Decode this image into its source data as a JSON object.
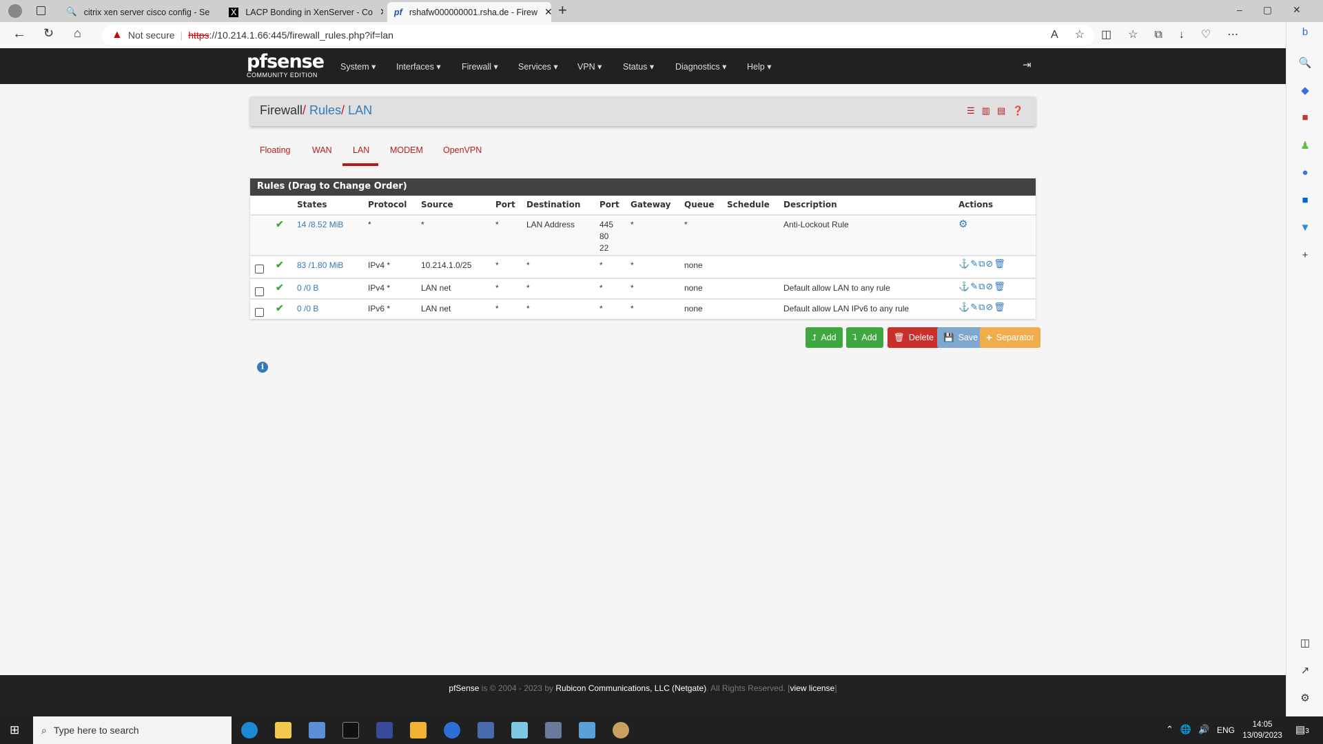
{
  "browser": {
    "tabs": [
      {
        "title": "citrix xen server cisco config - Se",
        "icon": "search-icon"
      },
      {
        "title": "LACP Bonding in XenServer - Co",
        "icon": "x-logo-icon"
      },
      {
        "title": "rshafw000000001.rsha.de - Firew",
        "icon": "pfsense-icon"
      }
    ],
    "not_secure": "Not secure",
    "url_scheme": "https",
    "url_rest": "://10.214.1.66:445/firewall_rules.php?if=lan"
  },
  "nav": {
    "logo": "pfsense",
    "logo_sub": "COMMUNITY EDITION",
    "items": [
      "System",
      "Interfaces",
      "Firewall",
      "Services",
      "VPN",
      "Status",
      "Diagnostics",
      "Help"
    ]
  },
  "breadcrumb": {
    "items": [
      "Firewall",
      "Rules",
      "LAN"
    ],
    "sep": "/"
  },
  "iface_tabs": [
    "Floating",
    "WAN",
    "LAN",
    "MODEM",
    "OpenVPN"
  ],
  "active_tab": "LAN",
  "panel": {
    "title": "Rules (Drag to Change Order)",
    "columns": [
      "States",
      "Protocol",
      "Source",
      "Port",
      "Destination",
      "Port",
      "Gateway",
      "Queue",
      "Schedule",
      "Description",
      "Actions"
    ],
    "rows": [
      {
        "checkbox": false,
        "states": "14 /8.52 MiB",
        "protocol": "*",
        "source": "*",
        "sport": "*",
        "destination": "LAN Address",
        "dport": [
          "445",
          "80",
          "22"
        ],
        "gateway": "*",
        "queue": "*",
        "schedule": "",
        "description": "Anti-Lockout Rule",
        "actions": "gear"
      },
      {
        "checkbox": true,
        "states": "83 /1.80 MiB",
        "protocol": "IPv4 *",
        "source": "10.214.1.0/25",
        "sport": "*",
        "destination": "*",
        "dport": [
          "*"
        ],
        "gateway": "*",
        "queue": "none",
        "schedule": "",
        "description": "",
        "actions": "full"
      },
      {
        "checkbox": true,
        "states": "0 /0 B",
        "protocol": "IPv4 *",
        "source": "LAN net",
        "sport": "*",
        "destination": "*",
        "dport": [
          "*"
        ],
        "gateway": "*",
        "queue": "none",
        "schedule": "",
        "description": "Default allow LAN to any rule",
        "actions": "full"
      },
      {
        "checkbox": true,
        "states": "0 /0 B",
        "protocol": "IPv6 *",
        "source": "LAN net",
        "sport": "*",
        "destination": "*",
        "dport": [
          "*"
        ],
        "gateway": "*",
        "queue": "none",
        "schedule": "",
        "description": "Default allow LAN IPv6 to any rule",
        "actions": "full"
      }
    ]
  },
  "buttons": {
    "add_top": "Add",
    "add_bottom": "Add",
    "delete": "Delete",
    "save": "Save",
    "separator": "Separator"
  },
  "footer": {
    "brand": "pfSense",
    "mid": " is © 2004 - 2023 by ",
    "company": "Rubicon Communications, LLC (Netgate)",
    "rights": ". All Rights Reserved. [",
    "license": "view license",
    "close": "]"
  },
  "taskbar": {
    "search_placeholder": "Type here to search",
    "lang": "ENG",
    "time": "14:05",
    "date": "13/09/2023",
    "notifications": "3"
  },
  "colors": {
    "accent_red": "#b71c1c",
    "link": "#337ab7",
    "success": "#3fa73f",
    "danger": "#c9302c",
    "save": "#7fa8d0",
    "warning": "#f0ad4e"
  }
}
